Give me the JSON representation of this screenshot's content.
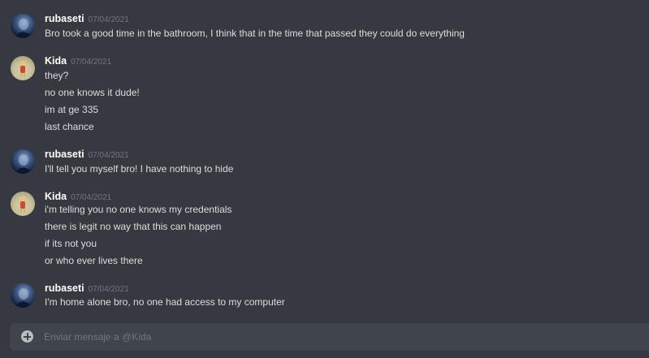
{
  "messages": [
    {
      "author": "rubaseti",
      "timestamp": "07/04/2021",
      "avatar": "rubaseti-avatar",
      "lines": [
        "Bro took a good time in the bathroom, I think that in the time that passed they could do everything"
      ]
    },
    {
      "author": "Kida",
      "timestamp": "07/04/2021",
      "avatar": "kida-avatar",
      "lines": [
        "they?",
        "no one knows it dude!",
        "im at ge 335",
        "last chance"
      ]
    },
    {
      "author": "rubaseti",
      "timestamp": "07/04/2021",
      "avatar": "rubaseti-avatar",
      "lines": [
        "I'll tell you myself bro! I have nothing to hide"
      ]
    },
    {
      "author": "Kida",
      "timestamp": "07/04/2021",
      "avatar": "kida-avatar",
      "lines": [
        "i'm telling you no one knows my credentials",
        "there is legit no way that this can happen",
        "if its not you",
        "or who ever lives there"
      ]
    },
    {
      "author": "rubaseti",
      "timestamp": "07/04/2021",
      "avatar": "rubaseti-avatar",
      "lines": [
        "I'm home alone bro, no one had access to my computer"
      ]
    }
  ],
  "composer": {
    "placeholder": "Enviar mensaje a @Kida",
    "value": "",
    "attach_icon": "plus-circle-icon"
  },
  "colors": {
    "background": "#36393f",
    "composer": "#40444b",
    "username": "#ffffff",
    "message_text": "#dcddde",
    "timestamp": "#72767d"
  }
}
